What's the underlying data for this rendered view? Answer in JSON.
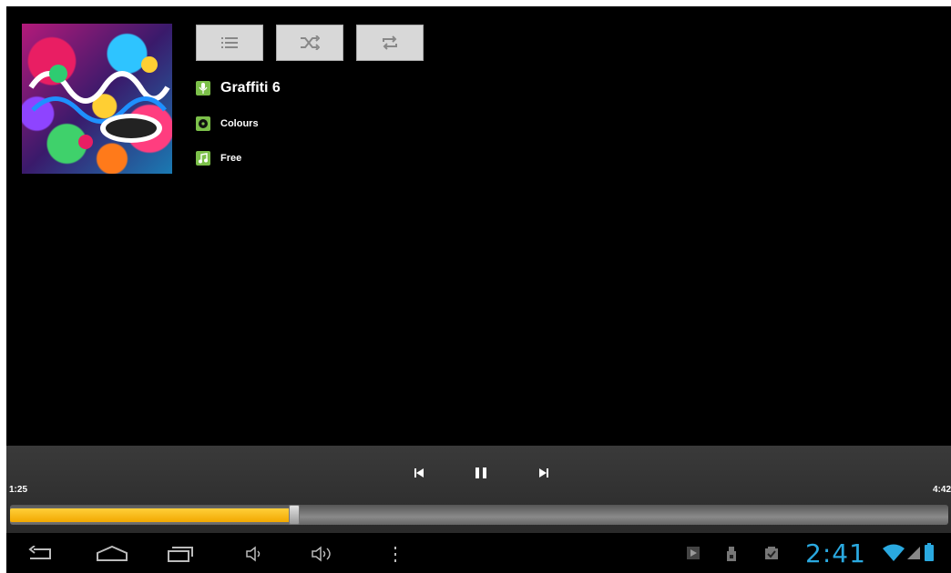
{
  "album": {
    "art_label": "Colours album art"
  },
  "toolbar": {
    "list_icon": "list-icon",
    "shuffle_icon": "shuffle-icon",
    "repeat_icon": "repeat-icon"
  },
  "track": {
    "artist": "Graffiti 6",
    "album": "Colours",
    "title": "Free"
  },
  "player": {
    "elapsed": "1:25",
    "duration": "4:42",
    "progress_fraction": 0.3
  },
  "statusbar": {
    "time": "2:41"
  },
  "colors": {
    "accent": "#f5b400",
    "meta_icon": "#7cc04a",
    "clock": "#2aa9e0"
  }
}
